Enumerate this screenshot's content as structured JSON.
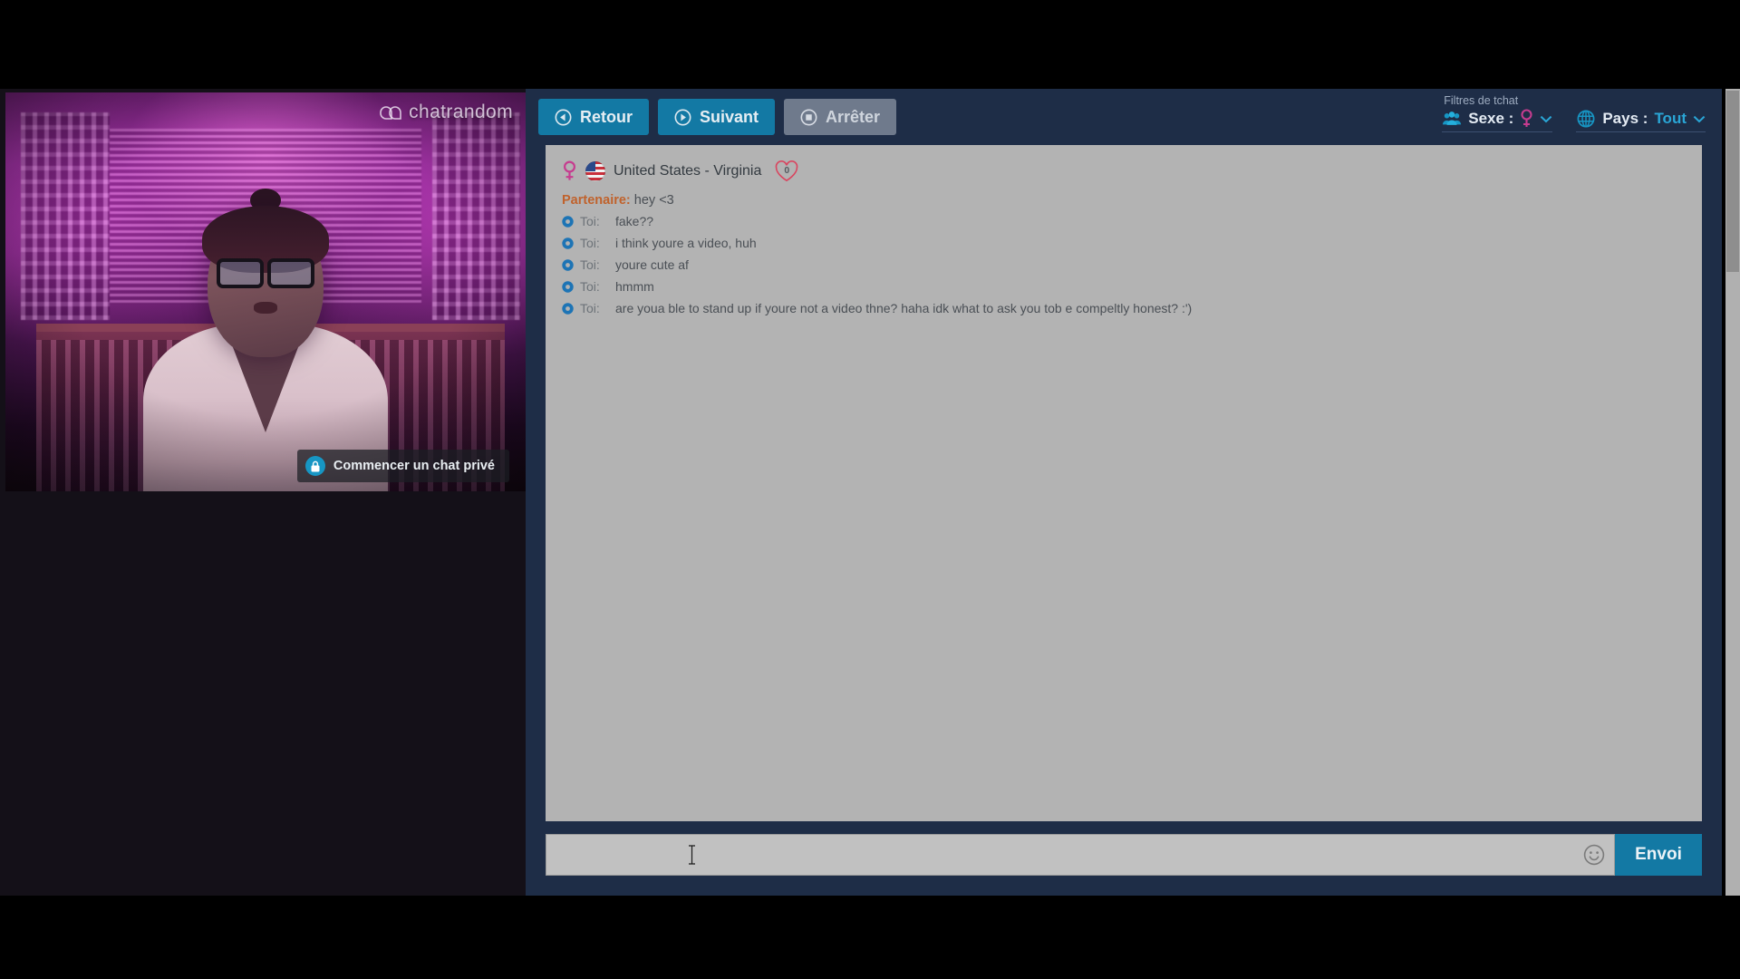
{
  "video": {
    "watermark": "chatrandom",
    "private_chat_label": "Commencer un chat privé"
  },
  "toolbar": {
    "back_label": "Retour",
    "next_label": "Suivant",
    "stop_label": "Arrêter",
    "stop_disabled": true,
    "accent_color": "#1379a4",
    "disabled_color": "#6f7a8c",
    "panel_color": "#1e2d47"
  },
  "filters": {
    "title": "Filtres de tchat",
    "sex_label": "Sexe :",
    "sex_value": "",
    "country_label": "Pays :",
    "country_value": "Tout",
    "value_color": "#2aa6d6"
  },
  "peer": {
    "gender": "female",
    "country_flag": "united-states",
    "location": "United States - Virginia",
    "likes": "0"
  },
  "chat": {
    "partner_name": "Partenaire:",
    "partner_message": "hey <3",
    "self_name": "Toi:",
    "background_color": "#b3b3b3",
    "messages": [
      {
        "who": "Toi:",
        "text": "fake??"
      },
      {
        "who": "Toi:",
        "text": "i think youre a video, huh"
      },
      {
        "who": "Toi:",
        "text": "youre cute af"
      },
      {
        "who": "Toi:",
        "text": "hmmm"
      },
      {
        "who": "Toi:",
        "text": "are youa ble to stand up if youre not a video thne? haha idk what to ask you tob e compeltly honest? :')"
      }
    ]
  },
  "composer": {
    "value": "",
    "placeholder": "",
    "send_label": "Envoi",
    "emoji_icon": "smiley-icon"
  }
}
